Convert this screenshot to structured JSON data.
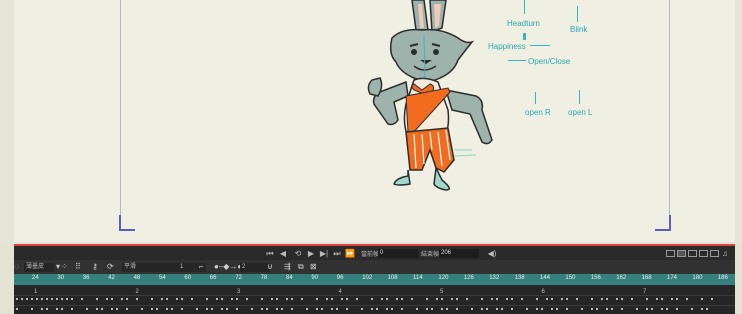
{
  "stage": {
    "annotations": [
      "Headturn",
      "Blink",
      "Happiness",
      "Open/Close",
      "open R",
      "open L"
    ]
  },
  "transport": {
    "current_frame_label": "當前幀",
    "current_frame_value": "0",
    "end_frame_label": "結束幀",
    "end_frame_value": "206"
  },
  "toolbar": {
    "layer_select": "薄墨皮",
    "ease_select": "平滑",
    "step_value": "1",
    "onion_value": "2"
  },
  "ruler": {
    "frames": [
      "24",
      "30",
      "36",
      "42",
      "48",
      "54",
      "60",
      "66",
      "72",
      "78",
      "84",
      "90",
      "96",
      "102",
      "108",
      "114",
      "120",
      "126",
      "132",
      "138",
      "144",
      "150",
      "156",
      "162",
      "168",
      "174",
      "180",
      "186"
    ]
  },
  "keys": {
    "row_labels": [
      "1",
      "2",
      "3",
      "4",
      "5",
      "6",
      "7"
    ]
  },
  "icon_names": [
    "play-first-icon",
    "step-back-icon",
    "play-icon",
    "step-forward-icon",
    "play-last-icon",
    "loop-icon",
    "speaker-icon",
    "headphones-icon",
    "lock-icon",
    "easing-icon"
  ]
}
